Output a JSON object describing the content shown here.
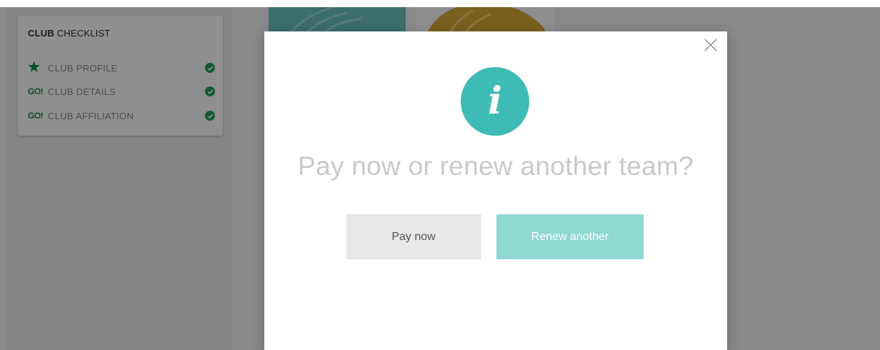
{
  "checklist": {
    "title_bold": "CLUB",
    "title_rest": " CHECKLIST",
    "items": [
      {
        "icon": "star-icon",
        "label": "CLUB PROFILE",
        "completed": true
      },
      {
        "icon_text": "GO!",
        "label": "CLUB DETAILS",
        "completed": true
      },
      {
        "icon_text": "GO!",
        "label": "CLUB AFFILIATION",
        "completed": true
      }
    ]
  },
  "modal": {
    "icon": "info-icon",
    "icon_glyph": "i",
    "title": "Pay now or renew another team?",
    "primary_button": "Pay now",
    "secondary_button": "Renew another",
    "close_icon": "close-icon"
  },
  "colors": {
    "accent_teal": "#3fbbb5",
    "renew_button": "#90d7d3",
    "check_green": "#27a35b",
    "go_green": "#1e8c4e"
  }
}
